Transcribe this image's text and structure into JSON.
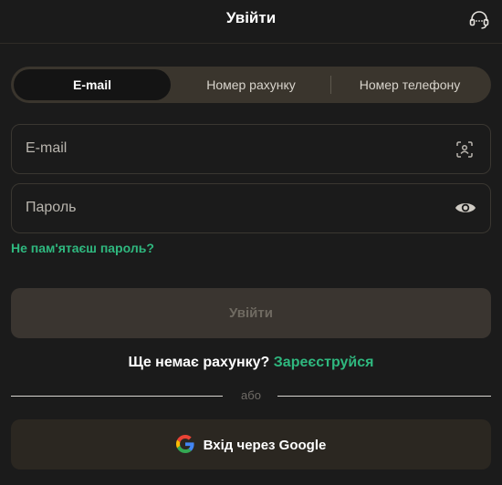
{
  "header": {
    "title": "Увійти",
    "support_icon": "headset-icon"
  },
  "tabs": [
    {
      "label": "E-mail",
      "active": true
    },
    {
      "label": "Номер рахунку",
      "active": false
    },
    {
      "label": "Номер телефону",
      "active": false
    }
  ],
  "form": {
    "email": {
      "placeholder": "E-mail",
      "value": "",
      "icon": "id-scan-icon"
    },
    "password": {
      "placeholder": "Пароль",
      "value": "",
      "icon": "eye-icon"
    },
    "forgot_label": "Не пам'ятаєш пароль?",
    "submit_label": "Увійти"
  },
  "signup": {
    "question": "Ще немає рахунку?",
    "link_label": "Зареєструйся"
  },
  "separator": {
    "label": "або"
  },
  "google": {
    "label": "Вхід через Google",
    "icon": "google-icon"
  },
  "colors": {
    "accent": "#2fb87f",
    "background": "#1b1b1b",
    "tabs_bg": "#3a352d",
    "button_disabled": "#3a3530"
  }
}
